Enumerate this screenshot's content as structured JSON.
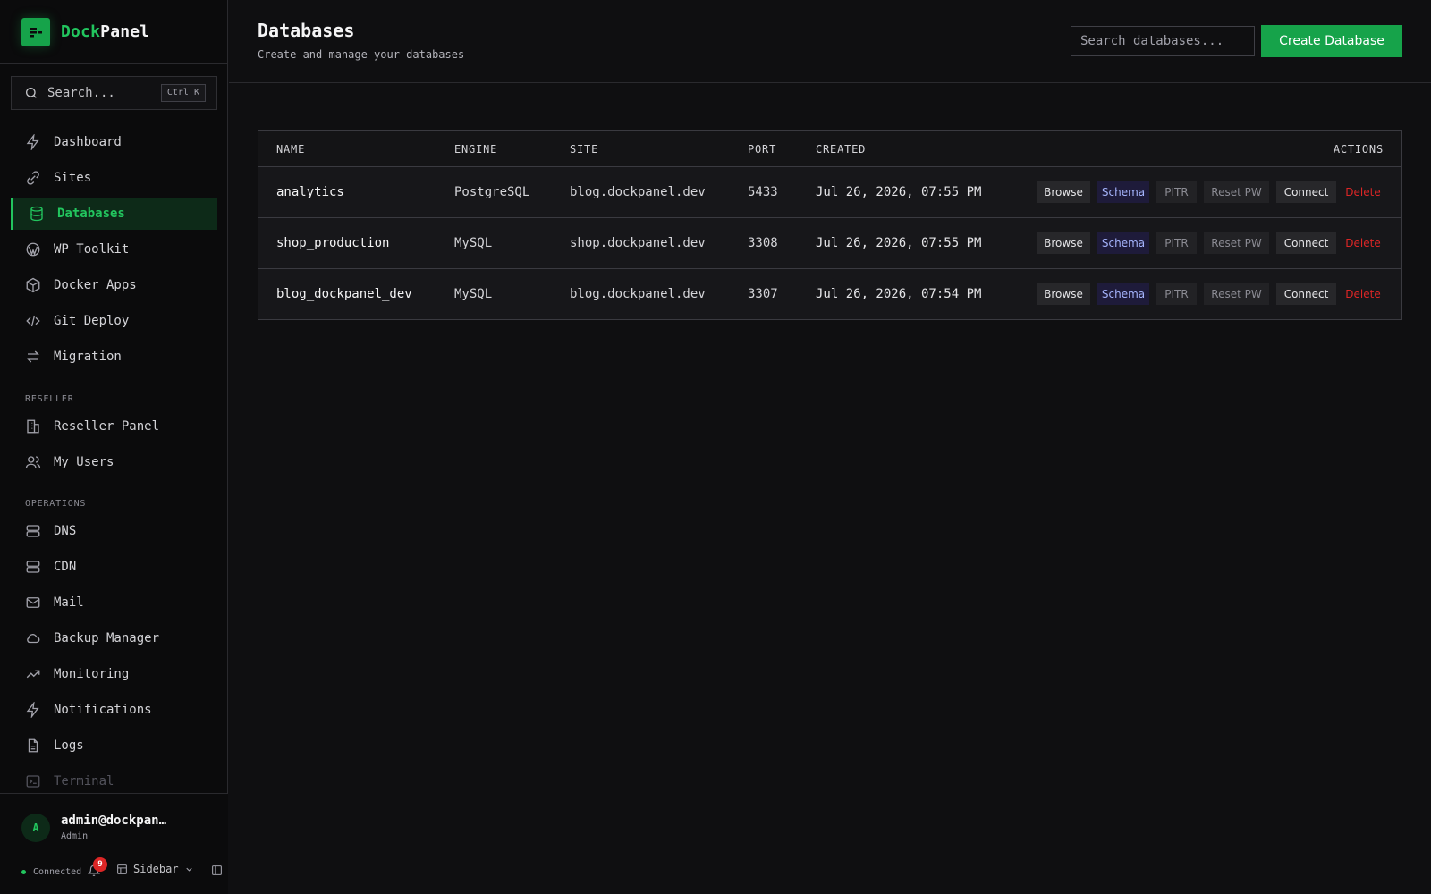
{
  "brand": {
    "part1": "Dock",
    "part2": "Panel"
  },
  "sidebar": {
    "search_placeholder": "Search...",
    "search_shortcut": "Ctrl K",
    "items": [
      {
        "label": "Dashboard",
        "icon": "bolt-icon"
      },
      {
        "label": "Sites",
        "icon": "globe-icon"
      },
      {
        "label": "Databases",
        "icon": "database-icon",
        "active": true
      },
      {
        "label": "WP Toolkit",
        "icon": "wordpress-icon"
      },
      {
        "label": "Docker Apps",
        "icon": "box-icon"
      },
      {
        "label": "Git Deploy",
        "icon": "code-icon"
      },
      {
        "label": "Migration",
        "icon": "arrows-icon"
      }
    ],
    "sections": [
      {
        "title": "RESELLER",
        "items": [
          {
            "label": "Reseller Panel",
            "icon": "building-icon"
          },
          {
            "label": "My Users",
            "icon": "users-icon"
          }
        ]
      },
      {
        "title": "OPERATIONS",
        "items": [
          {
            "label": "DNS",
            "icon": "server-icon"
          },
          {
            "label": "CDN",
            "icon": "server-icon"
          },
          {
            "label": "Mail",
            "icon": "mail-icon"
          },
          {
            "label": "Backup Manager",
            "icon": "cloud-icon"
          },
          {
            "label": "Monitoring",
            "icon": "trending-icon"
          },
          {
            "label": "Notifications",
            "icon": "bolt-icon"
          },
          {
            "label": "Logs",
            "icon": "file-icon"
          },
          {
            "label": "Terminal",
            "icon": "terminal-icon"
          }
        ]
      }
    ],
    "user": {
      "initial": "A",
      "email": "admin@dockpanel.dev",
      "role": "Admin"
    },
    "status": {
      "text": "Connected",
      "notifications": "9",
      "layout_label": "Sidebar"
    }
  },
  "header": {
    "title": "Databases",
    "subtitle": "Create and manage your databases",
    "search_placeholder": "Search databases...",
    "create_label": "Create Database"
  },
  "table": {
    "columns": [
      "NAME",
      "ENGINE",
      "SITE",
      "PORT",
      "CREATED",
      "ACTIONS"
    ],
    "rows": [
      {
        "name": "analytics",
        "engine": "PostgreSQL",
        "site": "blog.dockpanel.dev",
        "port": "5433",
        "created": "Jul 26, 2026, 07:55 PM"
      },
      {
        "name": "shop_production",
        "engine": "MySQL",
        "site": "shop.dockpanel.dev",
        "port": "3308",
        "created": "Jul 26, 2026, 07:55 PM"
      },
      {
        "name": "blog_dockpanel_dev",
        "engine": "MySQL",
        "site": "blog.dockpanel.dev",
        "port": "3307",
        "created": "Jul 26, 2026, 07:54 PM"
      }
    ],
    "actions": {
      "browse": "Browse",
      "schema": "Schema",
      "pitr": "PITR",
      "reset": "Reset PW",
      "connect": "Connect",
      "delete": "Delete"
    }
  },
  "colors": {
    "accent": "#22c55e",
    "primary_button": "#16a34a",
    "danger": "#dc2626",
    "schema": "#a5b4fc"
  }
}
